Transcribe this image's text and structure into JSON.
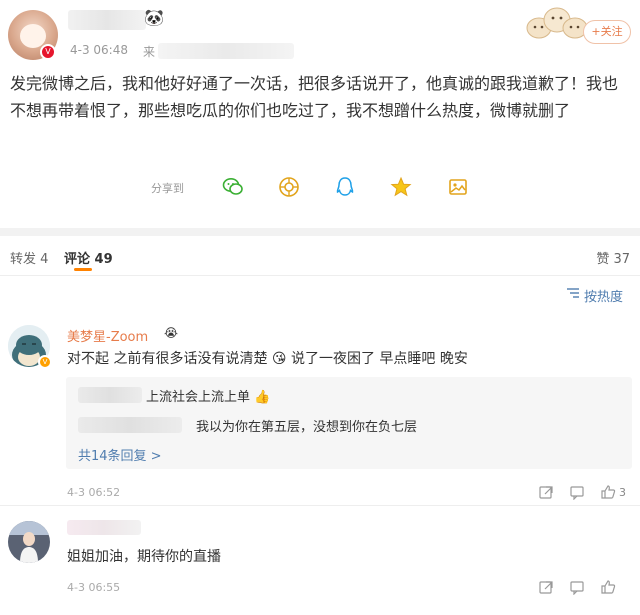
{
  "post": {
    "name_deco": "🐼",
    "time": "4-3 06:48",
    "source_prefix": "来",
    "follow_label": "+关注",
    "text": "发完微博之后，我和他好好通了一次话，把很多话说开了，他真诚的跟我道歉了！我也不想再带着恨了，那些想吃瓜的你们也吃过了，我不想蹭什么热度，微博就删了",
    "share_label": "分享到",
    "share_icons": [
      "wechat-icon",
      "moments-icon",
      "qq-icon",
      "qzone-icon",
      "picture-icon"
    ]
  },
  "tabs": {
    "repost": "转发 4",
    "comments": "评论 49",
    "likes": "赞 37"
  },
  "sort": {
    "label": "按热度",
    "icon": "sort-icon"
  },
  "comments": [
    {
      "name": "美梦星-Zoom",
      "name_emoji": "😭",
      "text": "对不起 之前有很多话没有说清楚 😘 说了一夜困了 早点睡吧 晚安",
      "replies": [
        "上流社会上流上单 👍",
        "我以为你在第五层，没想到你在负七层"
      ],
      "more_replies": "共14条回复 >",
      "time": "4-3 06:52",
      "likes": "3"
    },
    {
      "text": "姐姐加油，期待你的直播",
      "time": "4-3 06:55"
    }
  ],
  "colors": {
    "accent_orange": "#ff8200",
    "name_orange": "#e77c4b",
    "link_blue": "#507daf",
    "verified_red": "#e6162d"
  }
}
